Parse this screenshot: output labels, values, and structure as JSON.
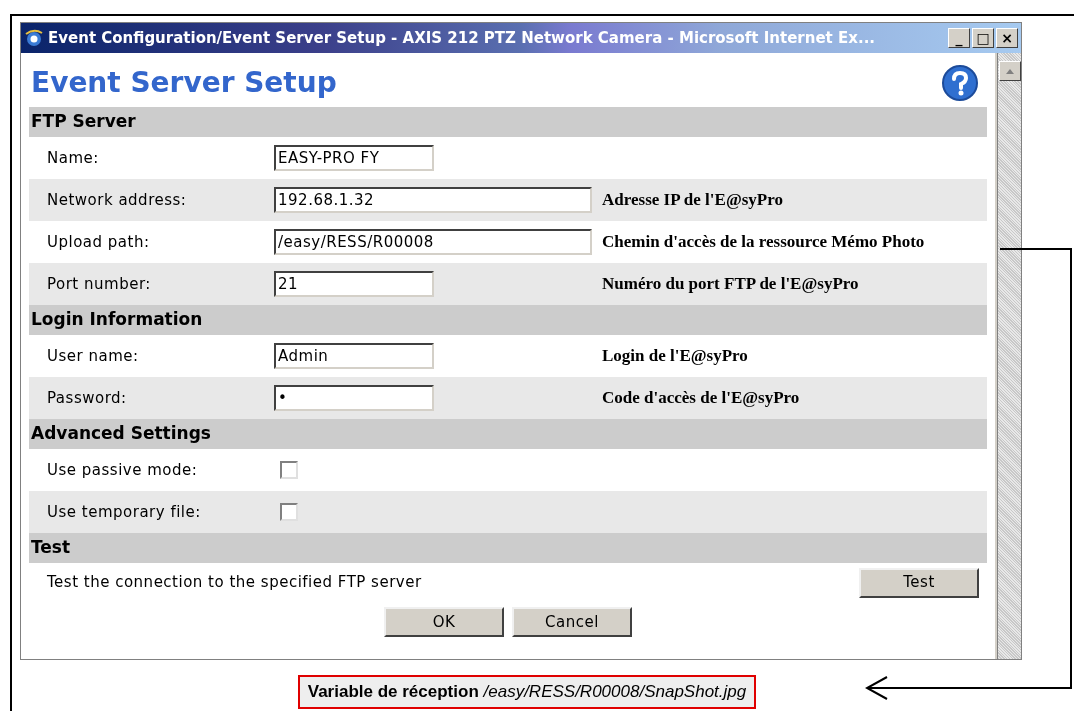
{
  "window": {
    "title": "Event Configuration/Event Server Setup - AXIS 212 PTZ Network Camera - Microsoft Internet Ex...",
    "controls": [
      "_",
      "□",
      "×"
    ]
  },
  "page_title": "Event Server Setup",
  "sections": [
    {
      "title": "FTP Server",
      "rows": [
        {
          "kind": "short_text",
          "label": "Name:",
          "value": "EASY-PRO FY"
        },
        {
          "kind": "long_text",
          "label": "Network address:",
          "value": "192.68.1.32",
          "note": "Adresse IP de l'E@syPro"
        },
        {
          "kind": "long_text",
          "label": "Upload path:",
          "value": "/easy/RESS/R00008",
          "note": "Chemin d'accès de la ressource Mémo Photo"
        },
        {
          "kind": "short_text",
          "label": "Port number:",
          "value": "21",
          "note": "Numéro du port FTP de l'E@syPro"
        }
      ]
    },
    {
      "title": "Login Information",
      "rows": [
        {
          "kind": "short_text",
          "label": "User name:",
          "value": "Admin",
          "note": "Login de l'E@syPro"
        },
        {
          "kind": "short_text",
          "label": "Password:",
          "value": "•",
          "note": "Code d'accès de l'E@syPro"
        }
      ]
    },
    {
      "title": "Advanced Settings",
      "rows": [
        {
          "kind": "checkbox",
          "label": "Use passive mode:",
          "checked": false
        },
        {
          "kind": "checkbox",
          "label": "Use temporary file:",
          "checked": false
        }
      ]
    },
    {
      "title": "Test",
      "rows": [
        {
          "kind": "action",
          "label": "Test the connection to the specified FTP server",
          "button": "Test"
        }
      ]
    }
  ],
  "buttons": [
    "OK",
    "Cancel"
  ],
  "caption": "**Variable de réception** */easy/RESS/R00008/SnapShot.jpg*"
}
